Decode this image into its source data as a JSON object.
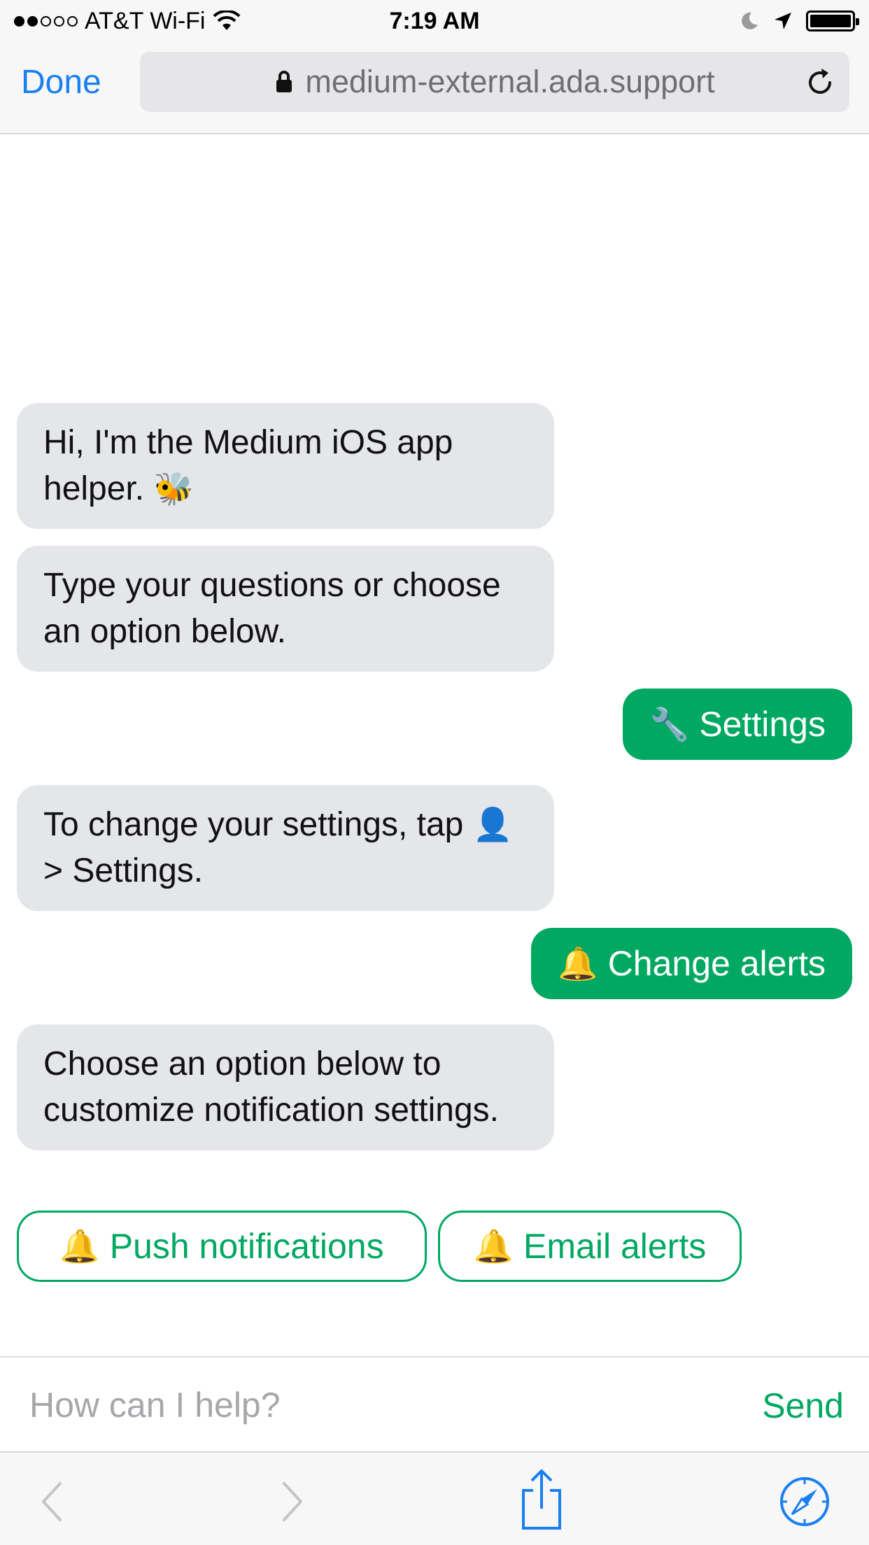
{
  "status_bar": {
    "carrier": "AT&T Wi-Fi",
    "time": "7:19 AM",
    "signal_bars_filled": 2,
    "signal_bars_total": 5,
    "battery_level": 1.0
  },
  "browser": {
    "done_label": "Done",
    "url": "medium-external.ada.support",
    "lock_icon": "lock-icon",
    "reload_icon": "reload-icon"
  },
  "chat": {
    "bot_message_1": {
      "text": "Hi, I'm the Medium iOS app helper.",
      "emoji": "🐝"
    },
    "bot_message_2": {
      "text": "Type your questions or choose an option below."
    },
    "user_message_1": {
      "emoji": "🔧",
      "text": "Settings"
    },
    "bot_message_3": {
      "text_before": "To change your settings, tap",
      "emoji": "👤",
      "text_after": "> Settings."
    },
    "user_message_2": {
      "emoji": "🔔",
      "text": "Change alerts"
    },
    "bot_message_4": {
      "text": "Choose an option below to customize notification settings."
    },
    "options": [
      {
        "emoji": "🔔",
        "label": "Push notifications"
      },
      {
        "emoji": "🔔",
        "label": "Email alerts"
      }
    ]
  },
  "composer": {
    "placeholder": "How can I help?",
    "value": "",
    "send_label": "Send"
  },
  "colors": {
    "accent": "#00a862",
    "link_blue": "#1a7ff0",
    "bubble_gray": "#e5e6ea"
  }
}
